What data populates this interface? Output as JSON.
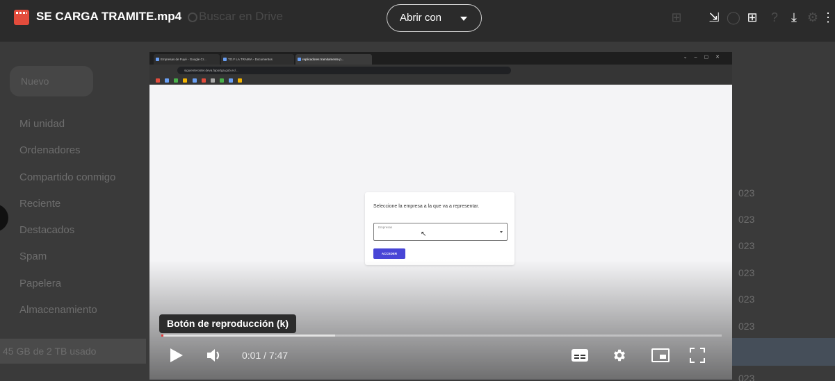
{
  "app": {
    "file_title": "SE CARGA TRAMITE.mp4",
    "search_ghost": "Buscar en Drive",
    "open_with_label": "Abrir con"
  },
  "drive_sidebar": {
    "new_label": "Nuevo",
    "items": [
      {
        "label": "Mi unidad"
      },
      {
        "label": "Ordenadores"
      },
      {
        "label": "Compartido conmigo"
      },
      {
        "label": "Reciente"
      },
      {
        "label": "Destacados"
      },
      {
        "label": "Spam"
      },
      {
        "label": "Papelera"
      },
      {
        "label": "Almacenamiento"
      }
    ],
    "storage_text": "45 GB de 2 TB usado"
  },
  "drive_dates": [
    "023",
    "023",
    "023",
    "023",
    "023",
    "023",
    "023"
  ],
  "video_page": {
    "tabs": [
      "Empresas de Fuyé - Google Cr...",
      "TO.F LA TRAMIA - Documentos",
      "replicadores tramitamente.p..."
    ],
    "url": "siguienteroster.deva.faportga.gob.ec/...",
    "card_title": "Seleccione la empresa a la que va a representar.",
    "select_label": "Empresas",
    "submit_label": "ACCEDER"
  },
  "player": {
    "tooltip": "Botón de reproducción (k)",
    "time": "0:01 / 7:47",
    "played_fraction": 0.002,
    "loaded_fraction": 0.31,
    "accent_color": "#e63a3a"
  }
}
